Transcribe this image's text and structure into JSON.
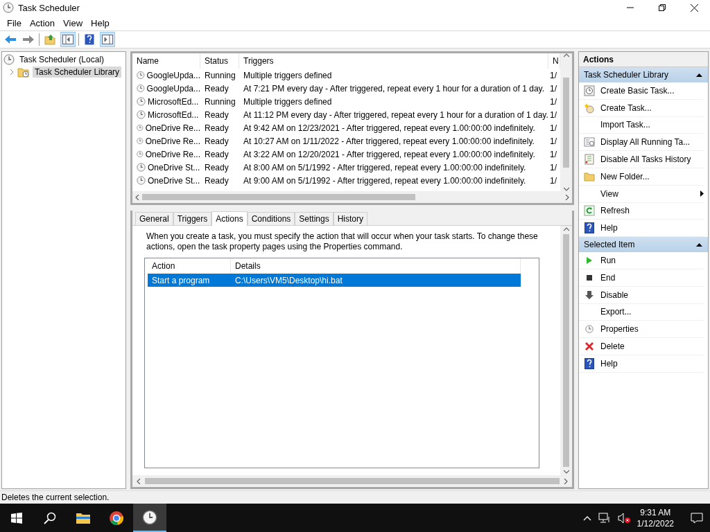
{
  "window": {
    "title": "Task Scheduler"
  },
  "menu": [
    "File",
    "Action",
    "View",
    "Help"
  ],
  "tree": [
    {
      "label": "Task Scheduler (Local)",
      "selected": false,
      "children": [
        {
          "label": "Task Scheduler Library",
          "selected": true,
          "expanded": false
        }
      ]
    }
  ],
  "task_list": {
    "columns": [
      "Name",
      "Status",
      "Triggers",
      "N"
    ],
    "rows": [
      {
        "name": "GoogleUpda...",
        "status": "Running",
        "triggers": "Multiple triggers defined",
        "column_4": "1/"
      },
      {
        "name": "GoogleUpda...",
        "status": "Ready",
        "triggers": "At 7:21 PM every day - After triggered, repeat every 1 hour for a duration of 1 day.",
        "column_4": "1/"
      },
      {
        "name": "MicrosoftEd...",
        "status": "Running",
        "triggers": "Multiple triggers defined",
        "column_4": "1/"
      },
      {
        "name": "MicrosoftEd...",
        "status": "Ready",
        "triggers": "At 11:12 PM every day - After triggered, repeat every 1 hour for a duration of 1 day.",
        "column_4": "1/"
      },
      {
        "name": "OneDrive Re...",
        "status": "Ready",
        "triggers": "At 9:42 AM on 12/23/2021 - After triggered, repeat every 1.00:00:00 indefinitely.",
        "column_4": "1/"
      },
      {
        "name": "OneDrive Re...",
        "status": "Ready",
        "triggers": "At 10:27 AM on 1/11/2022 - After triggered, repeat every 1.00:00:00 indefinitely.",
        "column_4": "1/"
      },
      {
        "name": "OneDrive Re...",
        "status": "Ready",
        "triggers": "At 3:22 AM on 12/20/2021 - After triggered, repeat every 1.00:00:00 indefinitely.",
        "column_4": "1/"
      },
      {
        "name": "OneDrive St...",
        "status": "Ready",
        "triggers": "At 8:00 AM on 5/1/1992 - After triggered, repeat every 1.00:00:00 indefinitely.",
        "column_4": "1/"
      },
      {
        "name": "OneDrive St...",
        "status": "Ready",
        "triggers": "At 9:00 AM on 5/1/1992 - After triggered, repeat every 1.00:00:00 indefinitely.",
        "column_4": "1/"
      }
    ]
  },
  "tabs": [
    {
      "label": "General",
      "selected": false
    },
    {
      "label": "Triggers",
      "selected": false
    },
    {
      "label": "Actions",
      "selected": true
    },
    {
      "label": "Conditions",
      "selected": false
    },
    {
      "label": "Settings",
      "selected": false
    },
    {
      "label": "History",
      "selected": false
    }
  ],
  "description": "When you create a task, you must specify the action that will occur when your task starts.  To change these actions, open the task property pages using the Properties command.",
  "actions_table": {
    "columns": [
      "Action",
      "Details"
    ],
    "rows": [
      {
        "action": "Start a program",
        "details": "C:\\Users\\VM5\\Desktop\\hi.bat",
        "selected": true
      }
    ]
  },
  "actions_pane": {
    "title": "Actions",
    "sections": [
      {
        "title": "Task Scheduler Library",
        "expanded": true,
        "items": [
          {
            "label": "Create Basic Task...",
            "kind": "wizard"
          },
          {
            "label": "Create Task...",
            "kind": "new-task"
          },
          {
            "label": "Import Task...",
            "kind": "none"
          },
          {
            "label": "Display All Running Ta...",
            "kind": "list"
          },
          {
            "label": "Disable All Tasks History",
            "kind": "history"
          },
          {
            "label": "New Folder...",
            "kind": "folder"
          },
          {
            "label": "View",
            "kind": "submenu"
          },
          {
            "label": "Refresh",
            "kind": "refresh"
          },
          {
            "label": "Help",
            "kind": "help"
          }
        ]
      },
      {
        "title": "Selected Item",
        "expanded": true,
        "items": [
          {
            "label": "Run",
            "kind": "run"
          },
          {
            "label": "End",
            "kind": "end"
          },
          {
            "label": "Disable",
            "kind": "disable"
          },
          {
            "label": "Export...",
            "kind": "none"
          },
          {
            "label": "Properties",
            "kind": "properties"
          },
          {
            "label": "Delete",
            "kind": "delete"
          },
          {
            "label": "Help",
            "kind": "help"
          }
        ]
      }
    ]
  },
  "status_bar": "Deletes the current selection.",
  "taskbar": {
    "time": "9:31 AM",
    "date": "1/12/2022"
  }
}
